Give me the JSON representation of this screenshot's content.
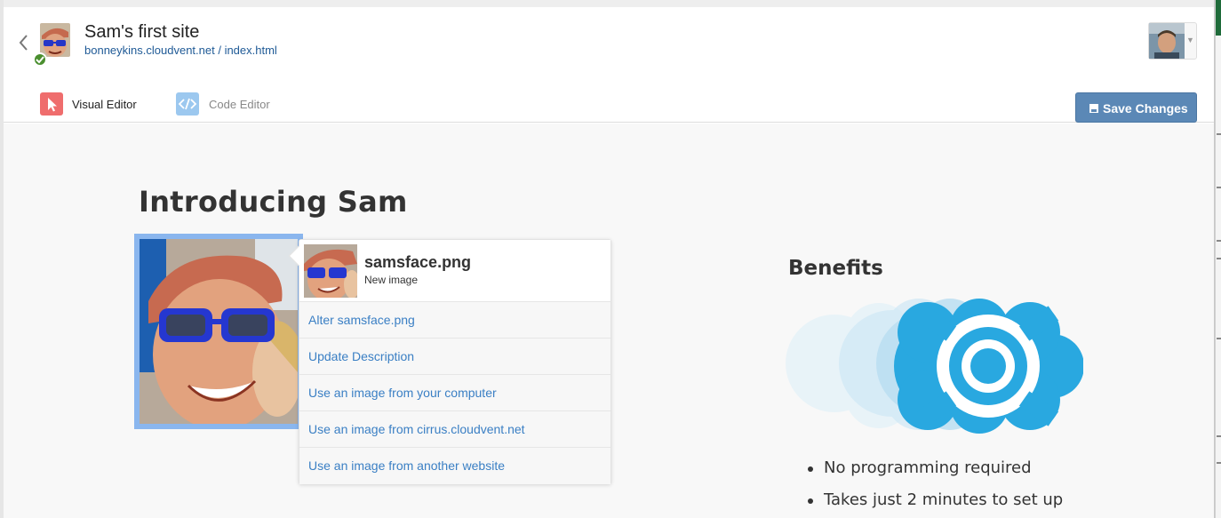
{
  "site": {
    "title": "Sam's first site",
    "domain": "bonneykins.cloudvent.net",
    "separator": " / ",
    "file": "index.html"
  },
  "tabs": [
    {
      "label": "Visual Editor",
      "active": true,
      "icon": "cursor-icon"
    },
    {
      "label": "Code Editor",
      "active": false,
      "icon": "code-icon"
    }
  ],
  "toolbar": {
    "save_label": "Save Changes",
    "save_icon": "save-icon"
  },
  "page": {
    "heading": "Introducing Sam",
    "benefits_title": "Benefits",
    "benefits": [
      "No programming required",
      "Takes just 2 minutes to set up"
    ]
  },
  "image_popover": {
    "file_name": "samsface.png",
    "subtitle": "New image",
    "actions": [
      "Alter samsface.png",
      "Update Description",
      "Use an image from your computer",
      "Use an image from cirrus.cloudvent.net",
      "Use an image from another website"
    ]
  },
  "colors": {
    "accent_blue": "#5b88b6",
    "link_blue": "#3a7fc4",
    "selection_blue": "#8ab6ee",
    "logo_blue": "#29a8e0",
    "visual_tab_red": "#ef6d6d",
    "status_green": "#4a8f2f"
  }
}
